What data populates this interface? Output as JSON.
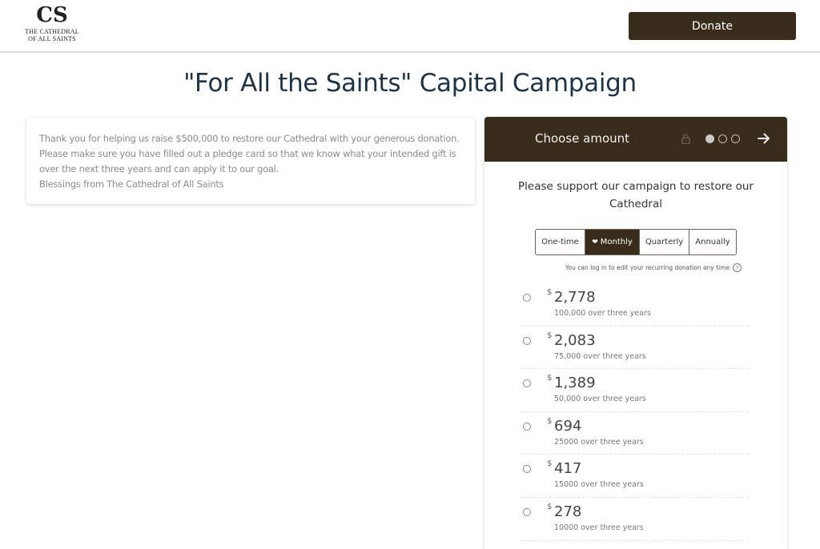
{
  "header": {
    "logo": {
      "monogram": "CS",
      "line1": "THE CATHEDRAL",
      "line2": "OF ALL SAINTS"
    },
    "donate_label": "Donate"
  },
  "page_title": "\"For All the Saints\" Capital Campaign",
  "info_card": {
    "lines": [
      "Thank you for helping us raise $500,000 to restore our Cathedral with your generous donation.",
      "Please make sure you have filled out a pledge card so that we know what your intended gift is",
      "over the next three years and can apply it to our goal.",
      "Blessings from The Cathedral of All Saints"
    ]
  },
  "widget": {
    "header": {
      "title": "Choose amount",
      "lock_icon": "lock-icon",
      "steps_total": 3,
      "step_current": 1,
      "next_icon": "arrow-right-icon"
    },
    "support_text": "Please support our campaign to restore our Cathedral",
    "frequency": {
      "options": [
        "One-time",
        "Monthly",
        "Quarterly",
        "Annually"
      ],
      "selected": "Monthly",
      "selected_icon": "heart-icon"
    },
    "recurring_note": "You can log in to edit your recurring donation any time",
    "help_icon": "?",
    "currency_symbol": "$",
    "amounts": [
      {
        "value": "2,778",
        "description": "100,000 over three years"
      },
      {
        "value": "2,083",
        "description": "75,000 over three years"
      },
      {
        "value": "1,389",
        "description": "50,000 over three years"
      },
      {
        "value": "694",
        "description": "25000 over three years"
      },
      {
        "value": "417",
        "description": "15000 over three years"
      },
      {
        "value": "278",
        "description": "10000 over three years"
      }
    ]
  },
  "colors": {
    "brand_dark": "#3a2c1a",
    "title_text": "#1e3446",
    "body_text_muted": "#8b8b8b"
  }
}
